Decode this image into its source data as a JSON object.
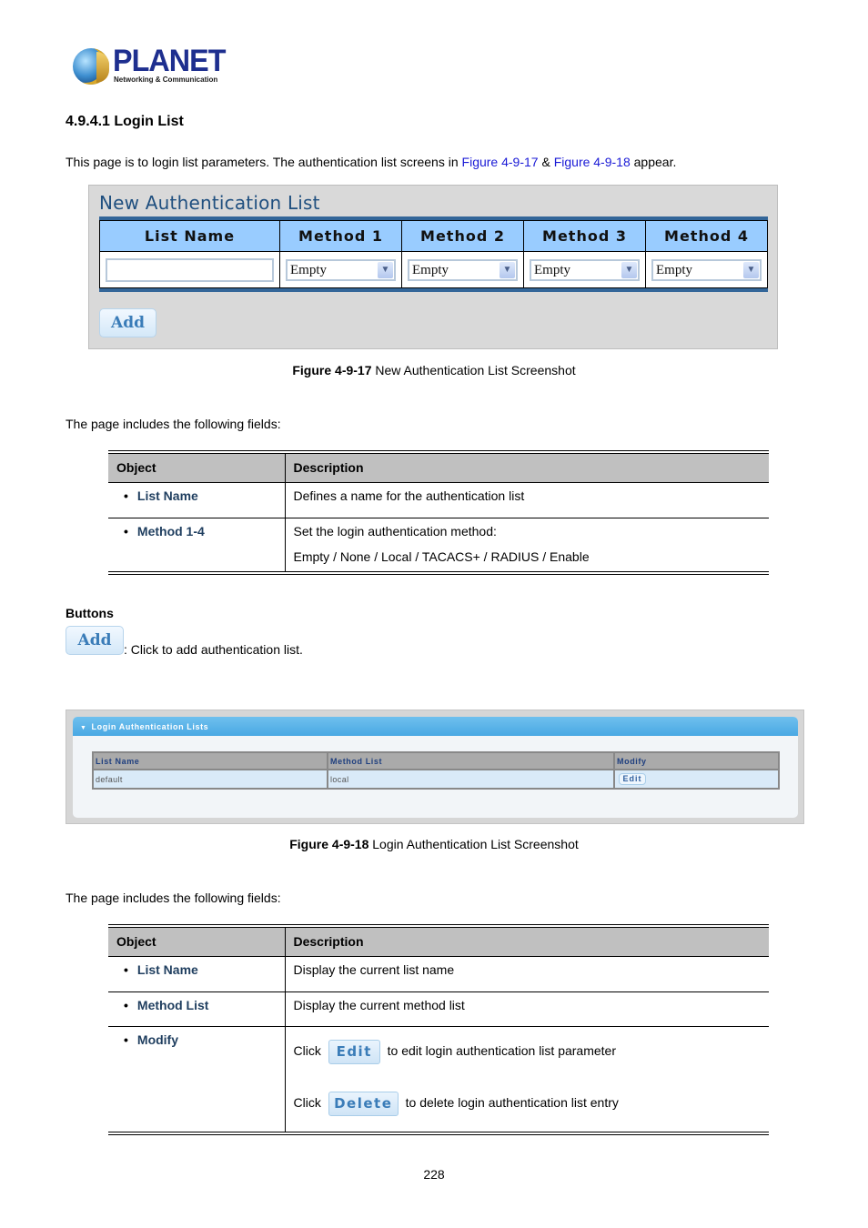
{
  "logo": {
    "name": "PLANET",
    "tagline": "Networking & Communication"
  },
  "section": {
    "title": "4.9.4.1 Login List",
    "intro_prefix": "This page is to login list parameters. The authentication list screens in ",
    "intro_link1": "Figure 4-9-17",
    "intro_mid": " & ",
    "intro_link2": "Figure 4-9-18",
    "intro_suffix": " appear."
  },
  "figure1": {
    "panel_title": "New Authentication List",
    "columns": [
      "List Name",
      "Method 1",
      "Method 2",
      "Method 3",
      "Method 4"
    ],
    "list_name_value": "",
    "methods": [
      "Empty",
      "Empty",
      "Empty",
      "Empty"
    ],
    "add_button": "Add",
    "caption_bold": "Figure 4-9-17",
    "caption_text": " New Authentication List Screenshot"
  },
  "fields_intro_1": "The page includes the following fields:",
  "table1": {
    "headers": [
      "Object",
      "Description"
    ],
    "rows": [
      {
        "object": "List Name",
        "desc": [
          "Defines a name for the authentication list"
        ]
      },
      {
        "object": "Method 1-4",
        "desc": [
          "Set the login authentication method:",
          "Empty / None / Local / TACACS+ / RADIUS / Enable"
        ]
      }
    ]
  },
  "buttons": {
    "heading": "Buttons",
    "add_label": "Add",
    "add_desc": ": Click to add authentication list."
  },
  "figure2": {
    "panel_title": "Login Authentication Lists",
    "columns": [
      "List Name",
      "Method List",
      "Modify"
    ],
    "rows": [
      {
        "list_name": "default",
        "method_list": "local",
        "modify": "Edit"
      }
    ],
    "caption_bold": "Figure 4-9-18",
    "caption_text": " Login Authentication List Screenshot"
  },
  "fields_intro_2": "The page includes the following fields:",
  "table2": {
    "headers": [
      "Object",
      "Description"
    ],
    "rows": [
      {
        "object": "List Name",
        "desc": "Display the current list name"
      },
      {
        "object": "Method List",
        "desc": "Display the current method list"
      },
      {
        "object": "Modify",
        "edit_prefix": "Click",
        "edit_label": "Edit",
        "edit_suffix": "to edit login authentication list parameter",
        "delete_prefix": "Click",
        "delete_label": "Delete",
        "delete_suffix": "to delete login authentication list entry"
      }
    ]
  },
  "page_number": "228"
}
